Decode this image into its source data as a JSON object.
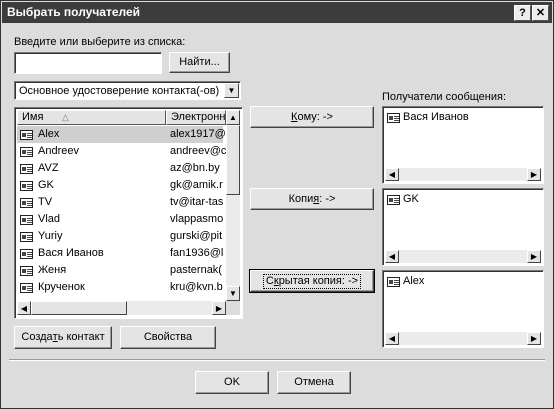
{
  "dialog": {
    "title": "Выбрать получателей",
    "help_glyph": "?",
    "close_glyph": "✕"
  },
  "search": {
    "label": "Введите или выберите из списка:",
    "value": "",
    "find_button": "Найти..."
  },
  "address_book": {
    "selected": "Основное удостоверение контакта(-ов)"
  },
  "contacts": {
    "col_name": "Имя",
    "col_email": "Электронн",
    "rows": [
      {
        "name": "Alex",
        "email": "alex1917@",
        "selected": true
      },
      {
        "name": "Andreev",
        "email": "andreev@c"
      },
      {
        "name": "AVZ",
        "email": "az@bn.by"
      },
      {
        "name": "GK",
        "email": "gk@amik.r"
      },
      {
        "name": "TV",
        "email": "tv@itar-tas"
      },
      {
        "name": "Vlad",
        "email": "vlappasmo"
      },
      {
        "name": "Yuriy",
        "email": "gurski@pit"
      },
      {
        "name": "Вася Иванов",
        "email": "fan1936@l"
      },
      {
        "name": "Женя",
        "email": "pasternak("
      },
      {
        "name": "Крученок",
        "email": "kru@kvn.b"
      }
    ]
  },
  "actions": {
    "to_pre": "",
    "to_key": "К",
    "to_post": "ому: ->",
    "cc_pre": "Копи",
    "cc_key": "я",
    "cc_post": ": ->",
    "bcc_pre": "С",
    "bcc_key": "к",
    "bcc_post": "рытая копия: ->"
  },
  "recipients": {
    "label": "Получатели сообщения:",
    "to": "Вася Иванов",
    "cc": "GK",
    "bcc": "Alex"
  },
  "bottom": {
    "create_pre": "Созда",
    "create_key": "т",
    "create_post": "ь контакт",
    "properties": "Свойства",
    "ok": "OK",
    "cancel": "Отмена"
  },
  "glyphs": {
    "up": "▲",
    "down": "▼",
    "left": "◀",
    "right": "▶",
    "sort": "△"
  }
}
